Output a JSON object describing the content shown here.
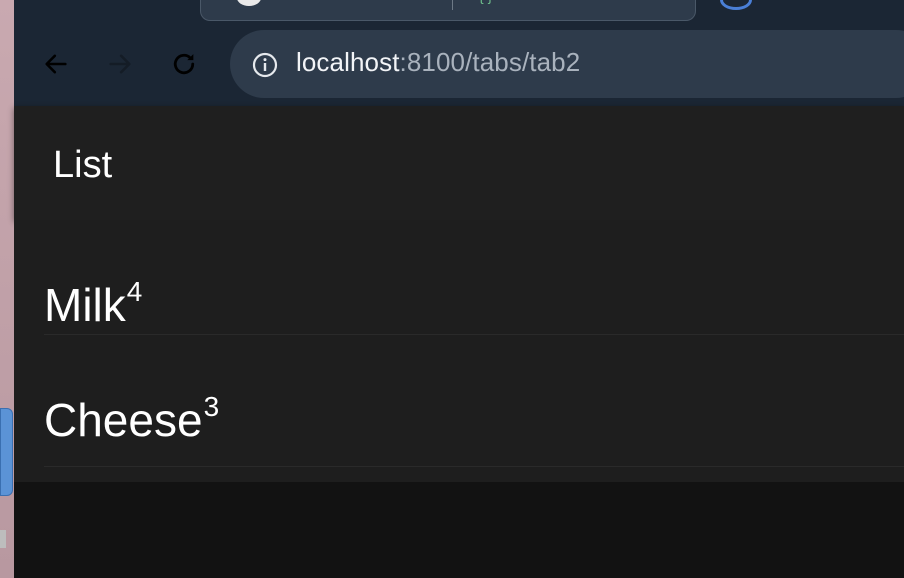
{
  "browser": {
    "url_host": "localhost",
    "url_path": ":8100/tabs/tab2"
  },
  "app": {
    "header_title": "List",
    "items": [
      {
        "name": "Milk",
        "count": "4"
      },
      {
        "name": "Cheese",
        "count": "3"
      }
    ]
  }
}
